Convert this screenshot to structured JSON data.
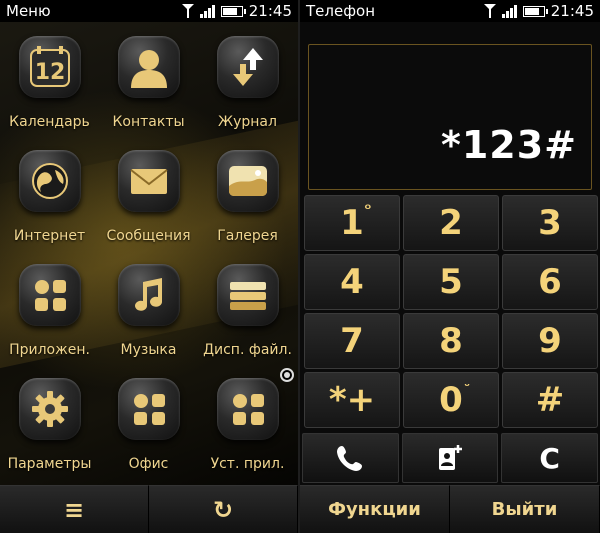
{
  "left": {
    "status_title": "Меню",
    "time": "21:45",
    "apps": [
      {
        "label": "Календарь",
        "icon": "calendar-icon",
        "badge": "12"
      },
      {
        "label": "Контакты",
        "icon": "contacts-icon"
      },
      {
        "label": "Журнал",
        "icon": "log-icon"
      },
      {
        "label": "Интернет",
        "icon": "globe-icon"
      },
      {
        "label": "Сообщения",
        "icon": "envelope-icon"
      },
      {
        "label": "Галерея",
        "icon": "gallery-icon"
      },
      {
        "label": "Приложен.",
        "icon": "apps-folder-icon"
      },
      {
        "label": "Музыка",
        "icon": "music-note-icon"
      },
      {
        "label": "Дисп. файл.",
        "icon": "file-manager-icon"
      },
      {
        "label": "Параметры",
        "icon": "gear-icon"
      },
      {
        "label": "Офис",
        "icon": "office-icon"
      },
      {
        "label": "Уст. прил.",
        "icon": "installed-apps-icon"
      }
    ],
    "softkeys": {
      "left_glyph": "≡",
      "right_glyph": "↻"
    }
  },
  "right": {
    "status_title": "Телефон",
    "time": "21:45",
    "display_value": "*123#",
    "keys": [
      {
        "label": "1",
        "sub": "ᴼ"
      },
      {
        "label": "2"
      },
      {
        "label": "3"
      },
      {
        "label": "4"
      },
      {
        "label": "5"
      },
      {
        "label": "6"
      },
      {
        "label": "7"
      },
      {
        "label": "8"
      },
      {
        "label": "9"
      },
      {
        "label": "*+"
      },
      {
        "label": "0",
        "sub": "ᵕ"
      },
      {
        "label": "#"
      }
    ],
    "actions": {
      "clear": "C"
    },
    "softkeys": {
      "left": "Функции",
      "right": "Выйти"
    }
  },
  "colors": {
    "accent_gold": "#f4d37a",
    "label_gold": "#f0d690"
  }
}
